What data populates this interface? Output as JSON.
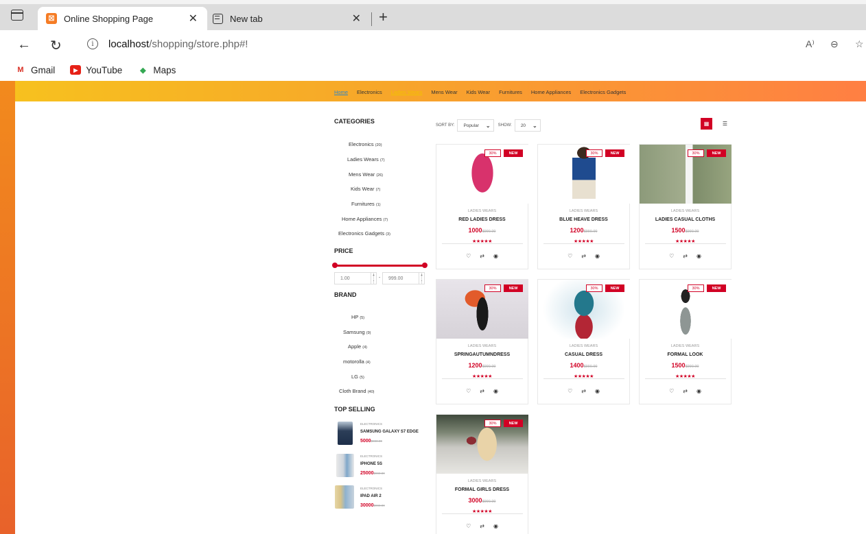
{
  "browser": {
    "tabs": [
      {
        "title": "Online Shopping Page",
        "close": "✕"
      },
      {
        "title": "New tab",
        "close": "✕"
      }
    ],
    "new_tab": "+",
    "url_host": "localhost",
    "url_path": "/shopping/store.php#!",
    "bookmarks": [
      {
        "label": "Gmail",
        "icon": "gmail-icon"
      },
      {
        "label": "YouTube",
        "icon": "youtube-icon"
      },
      {
        "label": "Maps",
        "icon": "maps-icon"
      }
    ]
  },
  "nav": [
    "Home",
    "Electronics",
    "Ladies Wears",
    "Mens Wear",
    "Kids Wear",
    "Furnitures",
    "Home Appliances",
    "Electronics Gadgets"
  ],
  "sidebar": {
    "categories_title": "CATEGORIES",
    "categories": [
      {
        "name": "Electronics",
        "count": "(20)"
      },
      {
        "name": "Ladies Wears",
        "count": "(7)"
      },
      {
        "name": "Mens Wear",
        "count": "(26)"
      },
      {
        "name": "Kids Wear",
        "count": "(7)"
      },
      {
        "name": "Furnitures",
        "count": "(1)"
      },
      {
        "name": "Home Appliances",
        "count": "(7)"
      },
      {
        "name": "Electronics Gadgets",
        "count": "(3)"
      }
    ],
    "price_title": "PRICE",
    "price_min": "1.00",
    "price_max": "999.00",
    "price_sep": "-",
    "brand_title": "BRAND",
    "brands": [
      {
        "name": "HP",
        "count": "(5)"
      },
      {
        "name": "Samsung",
        "count": "(9)"
      },
      {
        "name": "Apple",
        "count": "(4)"
      },
      {
        "name": "motorolla",
        "count": "(4)"
      },
      {
        "name": "LG",
        "count": "(5)"
      },
      {
        "name": "Cloth Brand",
        "count": "(40)"
      }
    ],
    "top_title": "TOP SELLING",
    "top_selling": [
      {
        "cat": "ELECTRONICS",
        "name": "SAMSUNG GALAXY S7 EDGE",
        "price": "5000",
        "old": "$990.00"
      },
      {
        "cat": "ELECTRONICS",
        "name": "IPHONE 5S",
        "price": "25000",
        "old": "$990.00"
      },
      {
        "cat": "ELECTRONICS",
        "name": "IPAD AIR 2",
        "price": "30000",
        "old": "$990.00"
      }
    ]
  },
  "store": {
    "sort_label": "SORT BY:",
    "sort_value": "Popular",
    "show_label": "SHOW:",
    "show_value": "20",
    "badge_sale": "30%",
    "badge_new": "NEW",
    "stars": "★★★★★",
    "old_price": "$990.00",
    "products": [
      {
        "cat": "LADIES WEARS",
        "name": "RED LADIES DRESS",
        "price": "1000"
      },
      {
        "cat": "LADIES WEARS",
        "name": "BLUE HEAVE DRESS",
        "price": "1200"
      },
      {
        "cat": "LADIES WEARS",
        "name": "LADIES CASUAL CLOTHS",
        "price": "1500"
      },
      {
        "cat": "LADIES WEARS",
        "name": "SPRINGAUTUMNDRESS",
        "price": "1200"
      },
      {
        "cat": "LADIES WEARS",
        "name": "CASUAL DRESS",
        "price": "1400"
      },
      {
        "cat": "LADIES WEARS",
        "name": "FORMAL LOOK",
        "price": "1500"
      },
      {
        "cat": "LADIES WEARS",
        "name": "FORMAL GIRLS DRESS",
        "price": "3000"
      }
    ]
  },
  "colors": {
    "accent": "#d10024",
    "grad_start": "#f7c21e",
    "grad_end": "#ff7f43"
  }
}
